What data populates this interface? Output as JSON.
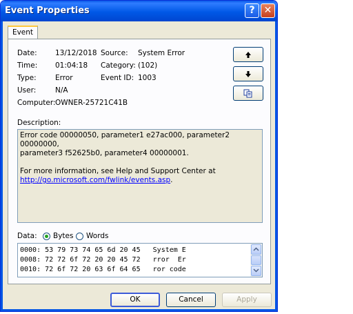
{
  "window": {
    "title": "Event Properties",
    "help_glyph": "?",
    "close_glyph": "✕"
  },
  "tab": {
    "label": "Event"
  },
  "fields": {
    "date_label": "Date:",
    "date_value": "13/12/2018",
    "source_label": "Source:",
    "source_value": "System Error",
    "time_label": "Time:",
    "time_value": "01:04:18",
    "category_label": "Category:",
    "category_value": "(102)",
    "type_label": "Type:",
    "type_value": "Error",
    "event_id_label": "Event ID:",
    "event_id_value": "1003",
    "user_label": "User:",
    "user_value": "N/A",
    "computer_label": "Computer:",
    "computer_value": "OWNER-25721C41B"
  },
  "nav_buttons": {
    "up_glyph": "🡑",
    "down_glyph": "🡓",
    "copy_icon": "copy-icon"
  },
  "description": {
    "label": "Description:",
    "line1": "Error code 00000050, parameter1 e27ac000, parameter2 00000000,",
    "line2": "parameter3 f52625b0, parameter4 00000001.",
    "line3": "For more information, see Help and Support Center at",
    "link": "http://go.microsoft.com/fwlink/events.asp",
    "link_suffix": "."
  },
  "data": {
    "label": "Data:",
    "bytes_label": "Bytes",
    "words_label": "Words",
    "selected": "Bytes",
    "rows": [
      "0000: 53 79 73 74 65 6d 20 45   System E",
      "0008: 72 72 6f 72 20 20 45 72   rror  Er",
      "0010: 72 6f 72 20 63 6f 64 65   ror code"
    ]
  },
  "buttons": {
    "ok": "OK",
    "cancel": "Cancel",
    "apply": "Apply"
  }
}
